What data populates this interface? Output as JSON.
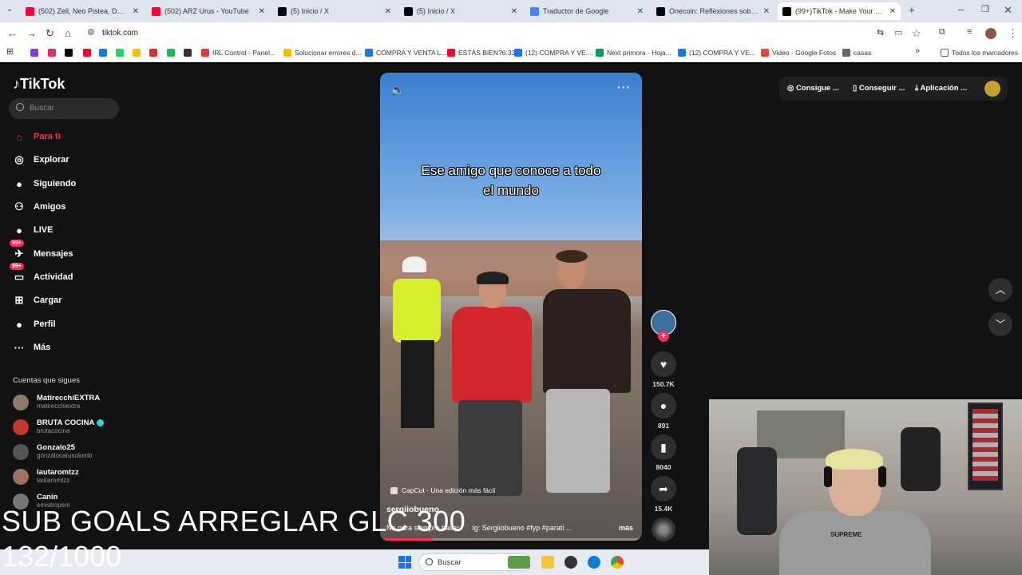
{
  "browser": {
    "tabs": [
      {
        "title": "(502) Zell, Neo Pistea, DUKI - S",
        "color": "#ff0033",
        "active": false
      },
      {
        "title": "(502) ARZ Urus - YouTube",
        "color": "#ff0033",
        "active": false
      },
      {
        "title": "(5) Inicio / X",
        "color": "#000000",
        "active": false
      },
      {
        "title": "(5) Inicio / X",
        "color": "#000000",
        "active": false
      },
      {
        "title": "Traductor de Google",
        "color": "#4285f4",
        "active": false
      },
      {
        "title": "Onecoin: Reflexiones sobre la M",
        "color": "#000000",
        "active": false
      },
      {
        "title": "(99+)TikTok - Make Your Day",
        "color": "#000000",
        "active": true
      }
    ],
    "url": "tiktok.com",
    "bookmarks": [
      {
        "label": "",
        "color": "#7b3fe4"
      },
      {
        "label": "",
        "color": "#e1306c"
      },
      {
        "label": "",
        "color": "#000000"
      },
      {
        "label": "",
        "color": "#ff0033"
      },
      {
        "label": "",
        "color": "#1877f2"
      },
      {
        "label": "",
        "color": "#25d366"
      },
      {
        "label": "",
        "color": "#fbbc04"
      },
      {
        "label": "",
        "color": "#d93025"
      },
      {
        "label": "",
        "color": "#1db954"
      },
      {
        "label": "",
        "color": "#333333"
      },
      {
        "label": "IRL Control - Panel...",
        "color": "#e53935"
      },
      {
        "label": "Solucionar errores d...",
        "color": "#fbbc04"
      },
      {
        "label": "COMPRA Y VENTA L...",
        "color": "#1877f2"
      },
      {
        "label": "ESTÁS BIEN?6:33",
        "color": "#ff0033"
      },
      {
        "label": "(12) COMPRA Y VE...",
        "color": "#1877f2"
      },
      {
        "label": "Next primora - Hoja...",
        "color": "#0f9d58"
      },
      {
        "label": "(12) COMPRA Y VE...",
        "color": "#1877f2"
      },
      {
        "label": "Video - Google Fotos",
        "color": "#ea4335"
      },
      {
        "label": "casas",
        "color": "#666666"
      }
    ],
    "all_bookmarks": "Todos los marcadores"
  },
  "tiktok": {
    "logo": "TikTok",
    "search_placeholder": "Buscar",
    "nav": [
      {
        "label": "Para ti",
        "icon": "home-icon",
        "glyph": "⌂"
      },
      {
        "label": "Explorar",
        "icon": "compass-icon",
        "glyph": "◎"
      },
      {
        "label": "Siguiendo",
        "icon": "following-avatar-icon",
        "glyph": "●"
      },
      {
        "label": "Amigos",
        "icon": "friends-icon",
        "glyph": "⚇"
      },
      {
        "label": "LIVE",
        "icon": "live-avatar-icon",
        "glyph": "●"
      },
      {
        "label": "Mensajes",
        "icon": "message-icon",
        "glyph": "✈"
      },
      {
        "label": "Actividad",
        "icon": "activity-icon",
        "glyph": "▭"
      },
      {
        "label": "Cargar",
        "icon": "upload-icon",
        "glyph": "⊞"
      },
      {
        "label": "Perfil",
        "icon": "profile-avatar-icon",
        "glyph": "●"
      },
      {
        "label": "Más",
        "icon": "more-icon",
        "glyph": "···"
      }
    ],
    "badge": "99+",
    "following_title": "Cuentas que sigues",
    "accounts": [
      {
        "name": "MatirecchiEXTRA",
        "handle": "matirecchiextra",
        "verified": false
      },
      {
        "name": "BRUTA COCINA",
        "handle": "brutacocina",
        "verified": true
      },
      {
        "name": "Gonzalo25",
        "handle": "gonzalocarusolomb",
        "verified": false
      },
      {
        "name": "lautaromtzz",
        "handle": "lautaromtzz",
        "verified": false
      },
      {
        "name": "Canin",
        "handle": "emistropeni",
        "verified": false
      }
    ],
    "video": {
      "caption_line1": "Ese amigo que conoce a todo",
      "caption_line2": "el mundo",
      "capcut": "CapCut · Una edición más fácil",
      "author": "sergiiobueno",
      "description": "No para siempre bailar  🎵  Ig: Sergiiobueno #fyp #parati ...",
      "more": "más",
      "progress": 0.2
    },
    "actions": {
      "likes": "150.7K",
      "comments": "891",
      "saves": "8040",
      "shares": "15.4K"
    },
    "topbar": {
      "coins": "Consigue ...",
      "get_app": "Conseguir ...",
      "app": "Aplicación ..."
    }
  },
  "overlay": {
    "line1": "SUB GOALS ARREGLAR GLC 300",
    "line2": "132/1000"
  },
  "taskbar": {
    "search": "Buscar"
  }
}
